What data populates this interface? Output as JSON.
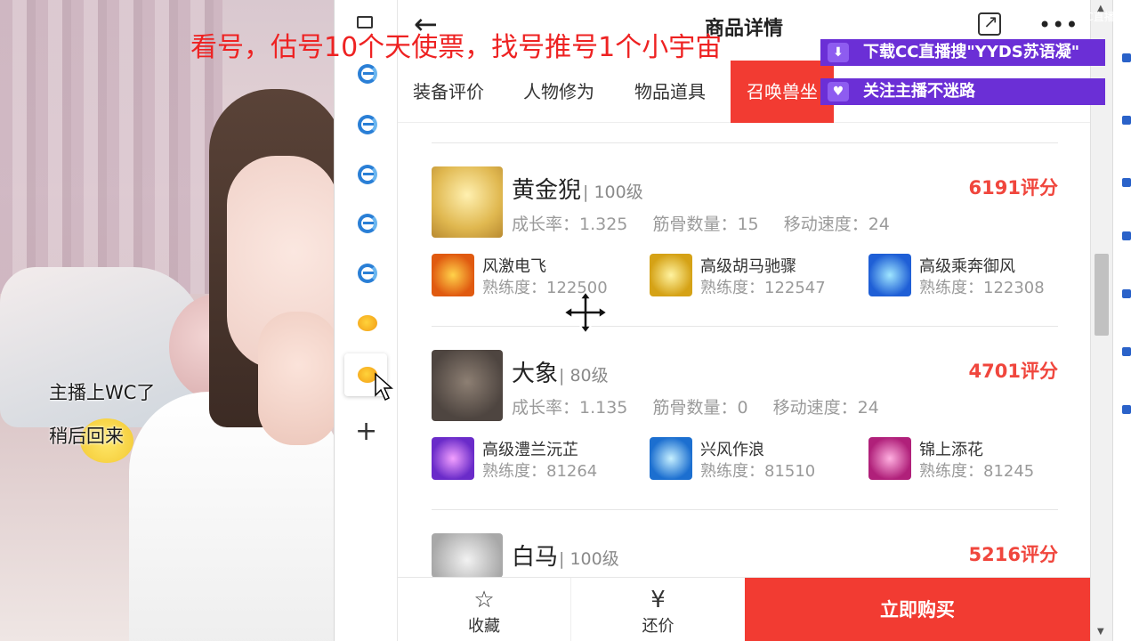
{
  "stream": {
    "caption_line1": "主播上WC了",
    "caption_line2": "稍后回来",
    "overlay_text": "看号，估号10个天使票，找号推号1个小宇宙",
    "banner1": {
      "prefix": "下载CC直播搜",
      "highlight": "\"YYDS苏语凝\""
    },
    "banner2": "关注主播不迷路",
    "accent": "#6b2fd6",
    "overlay_color": "#ee2222"
  },
  "header": {
    "back_icon": "back-arrow-icon",
    "title": "商品详情",
    "share_icon": "share-icon",
    "more_icon": "more-icon",
    "more_label": "•••"
  },
  "tabs": [
    {
      "label": "装备评价"
    },
    {
      "label": "人物修为"
    },
    {
      "label": "物品道具"
    },
    {
      "label": "召唤兽坐"
    }
  ],
  "pets": [
    {
      "name": "黄金猊",
      "level": "| 100级",
      "score": "6191评分",
      "growth": "成长率：1.325",
      "bones": "筋骨数量：15",
      "speed": "移动速度：24",
      "skills": [
        {
          "name": "风激电飞",
          "prof": "熟练度：122500"
        },
        {
          "name": "高级胡马驰骤",
          "prof": "熟练度：122547"
        },
        {
          "name": "高级乘奔御风",
          "prof": "熟练度：122308"
        }
      ]
    },
    {
      "name": "大象",
      "level": "| 80级",
      "score": "4701评分",
      "growth": "成长率：1.135",
      "bones": "筋骨数量：0",
      "speed": "移动速度：24",
      "skills": [
        {
          "name": "高级澧兰沅芷",
          "prof": "熟练度：81264"
        },
        {
          "name": "兴风作浪",
          "prof": "熟练度：81510"
        },
        {
          "name": "锦上添花",
          "prof": "熟练度：81245"
        }
      ]
    },
    {
      "name": "白马",
      "level": "| 100级",
      "score": "5216评分"
    }
  ],
  "bottom": {
    "fav_label": "收藏",
    "fav_icon": "star-icon",
    "bargain_label": "还价",
    "bargain_icon": "yen-icon",
    "buy_label": "立即购买",
    "brand_color": "#f23b32"
  },
  "watermark": "CC直播"
}
